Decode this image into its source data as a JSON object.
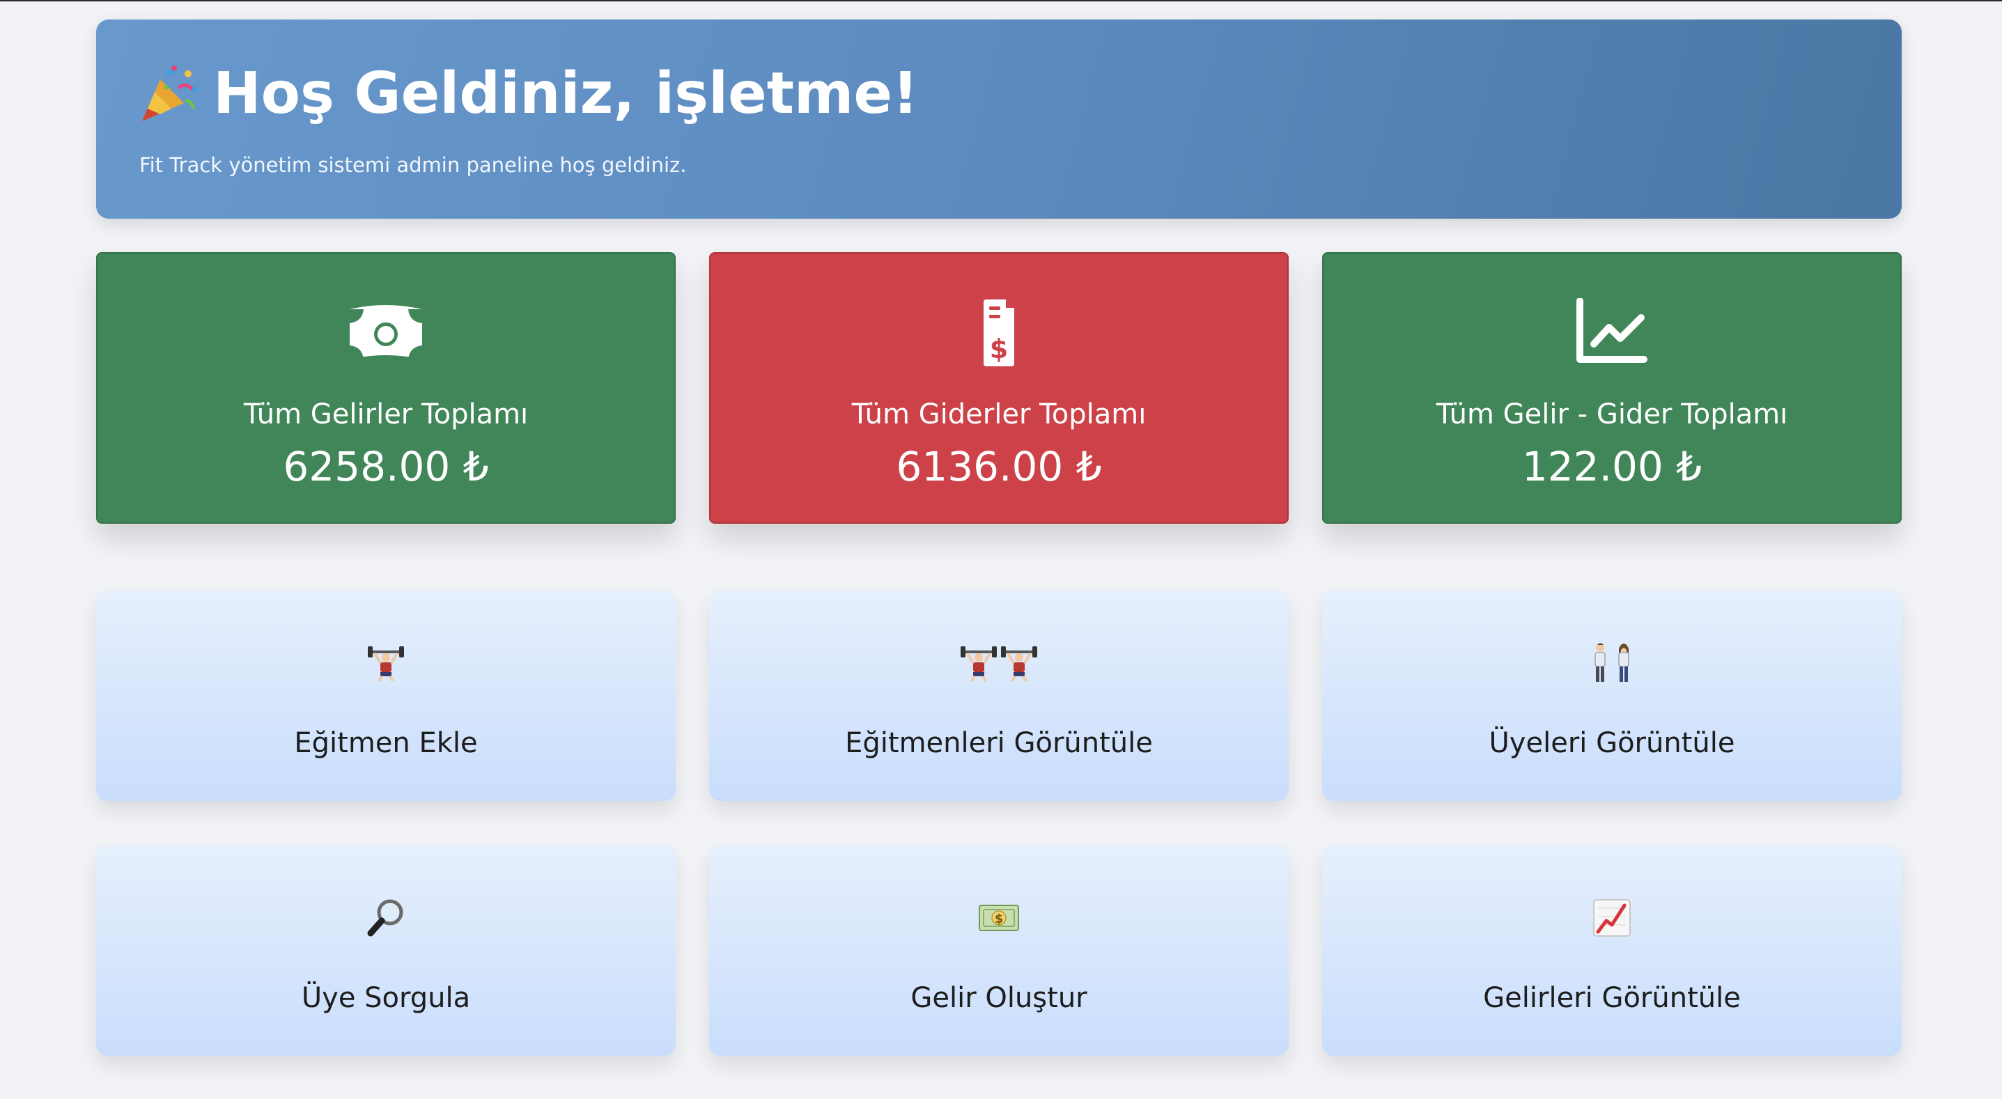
{
  "welcome": {
    "title": "Hoş Geldiniz, işletme!",
    "subtitle": "Fit Track yönetim sistemi admin paneline hoş geldiniz."
  },
  "stats": [
    {
      "label": "Tüm Gelirler Toplamı",
      "value": "6258.00 ₺",
      "color": "#408658",
      "icon": "money-bill-icon"
    },
    {
      "label": "Tüm Giderler Toplamı",
      "value": "6136.00 ₺",
      "color": "#cd4149",
      "icon": "invoice-dollar-icon"
    },
    {
      "label": "Tüm Gelir - Gider Toplamı",
      "value": "122.00 ₺",
      "color": "#408658",
      "icon": "line-chart-icon"
    }
  ],
  "tiles": [
    {
      "label": "Eğitmen Ekle",
      "icon": "weightlifter-icon"
    },
    {
      "label": "Eğitmenleri Görüntüle",
      "icon": "weightlifters-icon"
    },
    {
      "label": "Üyeleri Görüntüle",
      "icon": "people-icon"
    },
    {
      "label": "Üye Sorgula",
      "icon": "magnifier-icon"
    },
    {
      "label": "Gelir Oluştur",
      "icon": "banknote-icon"
    },
    {
      "label": "Gelirleri Görüntüle",
      "icon": "chart-increasing-icon"
    }
  ]
}
